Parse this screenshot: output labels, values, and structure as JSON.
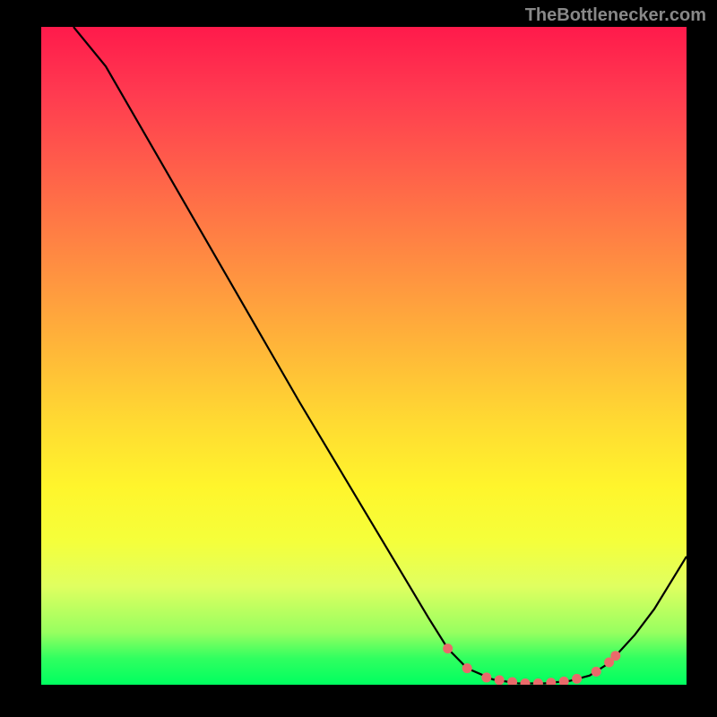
{
  "attribution": "TheBottlenecker.com",
  "chart_data": {
    "type": "line",
    "title": "",
    "xlabel": "",
    "ylabel": "",
    "xlim": [
      0,
      100
    ],
    "ylim": [
      0,
      100
    ],
    "series": [
      {
        "name": "curve",
        "x": [
          5,
          10,
          15,
          20,
          25,
          30,
          35,
          40,
          45,
          50,
          55,
          60,
          63,
          66,
          70,
          74,
          78,
          82,
          85,
          88,
          92,
          95,
          100
        ],
        "y": [
          100,
          94,
          85.5,
          77,
          68.5,
          60,
          51.5,
          43,
          34.8,
          26.6,
          18.4,
          10.2,
          5.5,
          2.5,
          0.8,
          0.2,
          0.2,
          0.6,
          1.4,
          3.3,
          7.6,
          11.5,
          19.5
        ]
      },
      {
        "name": "dots",
        "points": [
          {
            "x": 63,
            "y": 5.5
          },
          {
            "x": 66,
            "y": 2.5
          },
          {
            "x": 69,
            "y": 1.1
          },
          {
            "x": 71,
            "y": 0.7
          },
          {
            "x": 73,
            "y": 0.4
          },
          {
            "x": 75,
            "y": 0.2
          },
          {
            "x": 77,
            "y": 0.2
          },
          {
            "x": 79,
            "y": 0.3
          },
          {
            "x": 81,
            "y": 0.5
          },
          {
            "x": 83,
            "y": 0.9
          },
          {
            "x": 86,
            "y": 2.0
          },
          {
            "x": 88,
            "y": 3.4
          },
          {
            "x": 89,
            "y": 4.4
          }
        ]
      }
    ],
    "gradient_stops": [
      {
        "pos": 0,
        "color": "#ff1a4b"
      },
      {
        "pos": 50,
        "color": "#ffba38"
      },
      {
        "pos": 80,
        "color": "#f5ff3a"
      },
      {
        "pos": 100,
        "color": "#00ff60"
      }
    ]
  }
}
